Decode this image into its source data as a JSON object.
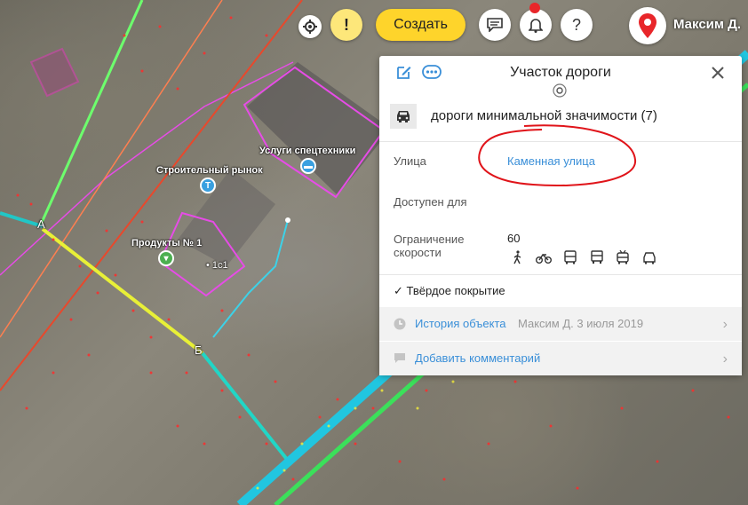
{
  "toolbar": {
    "settings_icon": "gear-icon",
    "alert_icon": "exclamation-icon",
    "create_label": "Создать",
    "chat_icon": "chat-icon",
    "bell_icon": "bell-icon",
    "help_label": "?",
    "logo_icon": "map-pin-logo-icon",
    "user_name": "Максим Д.",
    "colors": {
      "accent": "#fed42b",
      "logo": "#e8262a",
      "notification": "#e8262a"
    }
  },
  "map": {
    "labels": {
      "market": "Строительный рынок",
      "services": "Услуги спецтехники",
      "products": "Продукты № 1",
      "house": "1с1",
      "point_a": "А",
      "point_b": "Б"
    }
  },
  "panel": {
    "title": "Участок дороги",
    "edit_icon": "edit-icon",
    "more_icon": "more-icon",
    "close_icon": "close-icon",
    "road_type": "дороги минимальной значимости (7)",
    "street_label": "Улица",
    "street_value": "Каменная улица",
    "access_label": "Доступен для",
    "access_icons": [
      "pedestrian-icon",
      "bicycle-icon",
      "bus-icon",
      "truck-icon",
      "trolleybus-icon",
      "car-icon"
    ],
    "speed_label_1": "Ограничение",
    "speed_label_2": "скорости",
    "speed_value": "60",
    "surface": "✓ Твёрдое покрытие",
    "history_label": "История объекта",
    "history_meta": "Максим Д. 3 июля 2019",
    "comment_label": "Добавить комментарий",
    "colors": {
      "link": "#3a8fd8",
      "annotation": "#e0141a"
    }
  }
}
